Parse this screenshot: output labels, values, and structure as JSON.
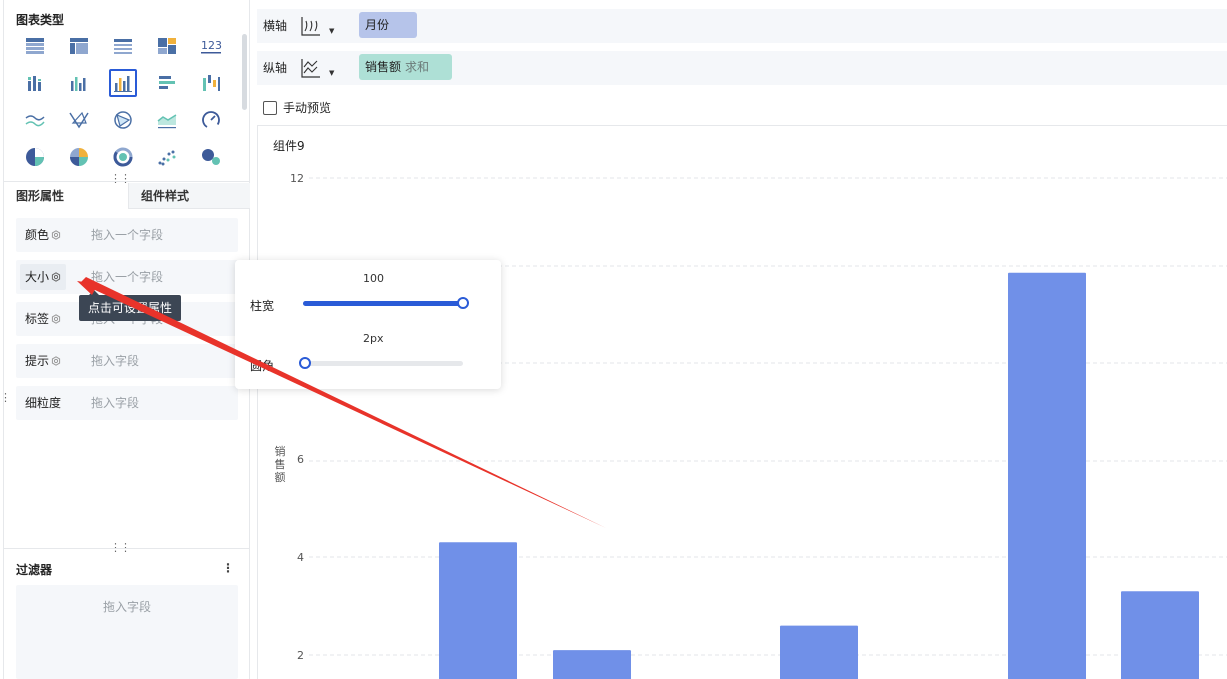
{
  "left_panel": {
    "chart_types_title": "图表类型",
    "chart_type_icons": [
      "table-icon",
      "cross-table-icon",
      "detail-table-icon",
      "tile-icon",
      "number-card-icon",
      "stacked-column-icon",
      "column-icon",
      "grouped-column-icon",
      "bar-icon",
      "waterfall-icon",
      "line-icon",
      "radar-icon",
      "flow-icon",
      "area-icon",
      "gauge-icon",
      "pie-icon",
      "rose-pie-icon",
      "ring-icon",
      "scatter-icon",
      "bubble-icon"
    ],
    "selected_chart_type": "grouped-column-icon",
    "tabs": {
      "graph_props": "图形属性",
      "component_style": "组件样式"
    },
    "properties": [
      {
        "label": "颜色",
        "placeholder": "拖入一个字段",
        "has_gear": true
      },
      {
        "label": "大小",
        "placeholder": "拖入一个字段",
        "has_gear": true
      },
      {
        "label": "标签",
        "placeholder": "拖入一个字段",
        "has_gear": true
      },
      {
        "label": "提示",
        "placeholder": "拖入字段",
        "has_gear": true
      },
      {
        "label": "细粒度",
        "placeholder": "拖入字段",
        "has_gear": false
      }
    ],
    "tooltip": "点击可设置属性",
    "filter_title": "过滤器",
    "filter_placeholder": "拖入字段"
  },
  "axes": {
    "x_label": "横轴",
    "x_field": "月份",
    "y_label": "纵轴",
    "y_field": "销售额",
    "y_agg": "求和"
  },
  "manual_preview": {
    "label": "手动预览",
    "checked": false
  },
  "popover": {
    "bar_width_label": "柱宽",
    "bar_width_value_text": "100",
    "bar_width_fraction": 1.0,
    "radius_label": "圆角",
    "radius_value_text": "2px",
    "radius_fraction": 0.0
  },
  "chart": {
    "title": "组件9"
  },
  "chart_data": {
    "type": "bar",
    "ylabel": "销售额",
    "y_ticks": [
      "12",
      "6",
      "4",
      "2"
    ],
    "y_tick_values": [
      12,
      6,
      4,
      2
    ],
    "values": [
      4.3,
      2.1,
      2.6,
      9.8,
      3.3
    ],
    "color": "#7090e8"
  },
  "colors": {
    "accent": "#2a5bd7",
    "bar": "#7090e8",
    "arrow": "#e8332a"
  }
}
